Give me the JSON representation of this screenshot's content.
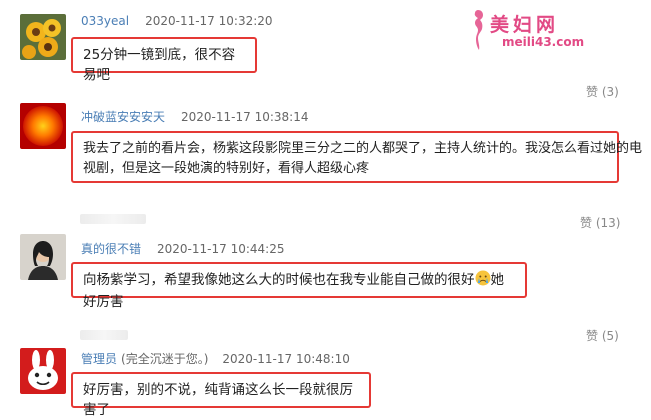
{
  "watermark": {
    "title": "美妇网",
    "url": "meili43.com"
  },
  "like_label": "赞",
  "comments": [
    {
      "username": "033yeal",
      "time": "2020-11-17 10:32:20",
      "text": "25分钟一镜到底，很不容易吧",
      "likes": "(3)"
    },
    {
      "username": "冲破蓝安安安天",
      "time": "2020-11-17 10:38:14",
      "text_line1": "我去了之前的看片会，杨紫这段影院里三分之二的人都哭了，主持人统计的。我没怎么看过她的电",
      "text_line2": "视剧，但是这一段她演的特别好，看得人超级心疼",
      "likes": "(13)"
    },
    {
      "username": "真的很不错",
      "time": "2020-11-17 10:44:25",
      "text_before_emoji": "向杨紫学习，希望我像她这么大的时候也在我专业能自己做的很好",
      "text_after_emoji": "她好厉害",
      "likes": "(5)"
    },
    {
      "username": "管理员",
      "user_note": "(完全沉迷于您。)",
      "time": "2020-11-17 10:48:10",
      "text": "好厉害，别的不说，纯背诵这么长一段就很厉害了"
    }
  ]
}
